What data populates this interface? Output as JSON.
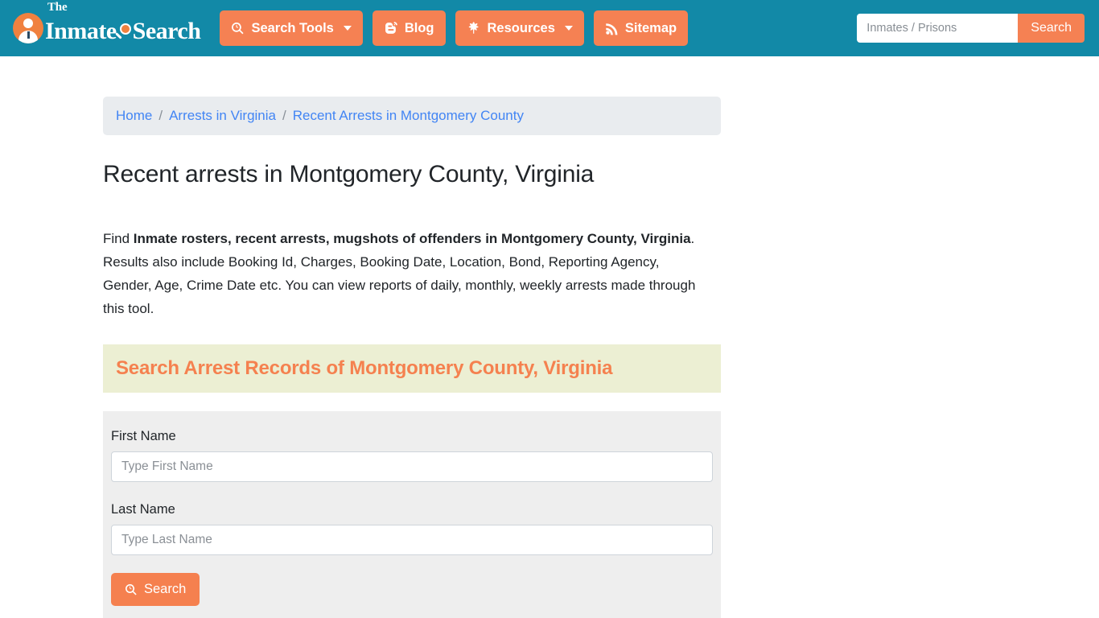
{
  "header": {
    "brand": {
      "the": "The",
      "word1": "Inmate",
      "word2": "Search"
    },
    "nav": [
      {
        "id": "search-tools",
        "label": "Search Tools",
        "icon": "magnifier-icon",
        "caret": true
      },
      {
        "id": "blog",
        "label": "Blog",
        "icon": "blogger-icon",
        "caret": false
      },
      {
        "id": "resources",
        "label": "Resources",
        "icon": "leaf-icon",
        "caret": true
      },
      {
        "id": "sitemap",
        "label": "Sitemap",
        "icon": "rss-icon",
        "caret": false
      }
    ],
    "search": {
      "placeholder": "Inmates / Prisons",
      "value": "",
      "button_label": "Search"
    }
  },
  "breadcrumb": {
    "items": [
      {
        "label": "Home",
        "current": false
      },
      {
        "label": "Arrests in Virginia",
        "current": false
      },
      {
        "label": "Recent Arrests in Montgomery County",
        "current": true
      }
    ],
    "separator": "/"
  },
  "main": {
    "title": "Recent arrests in Montgomery County, Virginia",
    "intro": {
      "lead": "Find ",
      "bold": "Inmate rosters, recent arrests, mugshots of offenders in Montgomery County, Virginia",
      "rest": ". Results also include Booking Id, Charges, Booking Date, Location, Bond, Reporting Agency, Gender, Age, Crime Date etc. You can view reports of daily, monthly, weekly arrests made through this tool."
    },
    "panel_heading": "Search Arrest Records of Montgomery County, Virginia",
    "form": {
      "fields": [
        {
          "id": "first-name",
          "label": "First Name",
          "placeholder": "Type First Name",
          "value": ""
        },
        {
          "id": "last-name",
          "label": "Last Name",
          "placeholder": "Type Last Name",
          "value": ""
        }
      ],
      "submit_label": "Search",
      "submit_icon": "magnifier-icon"
    }
  },
  "colors": {
    "header_teal": "#1289a7",
    "accent_orange": "#f58153",
    "panel_cream": "#ecefd3",
    "form_gray": "#eeeeee",
    "breadcrumb_gray": "#e9ecef",
    "link_blue": "#4285f4",
    "heading_orange": "#f5814f"
  }
}
